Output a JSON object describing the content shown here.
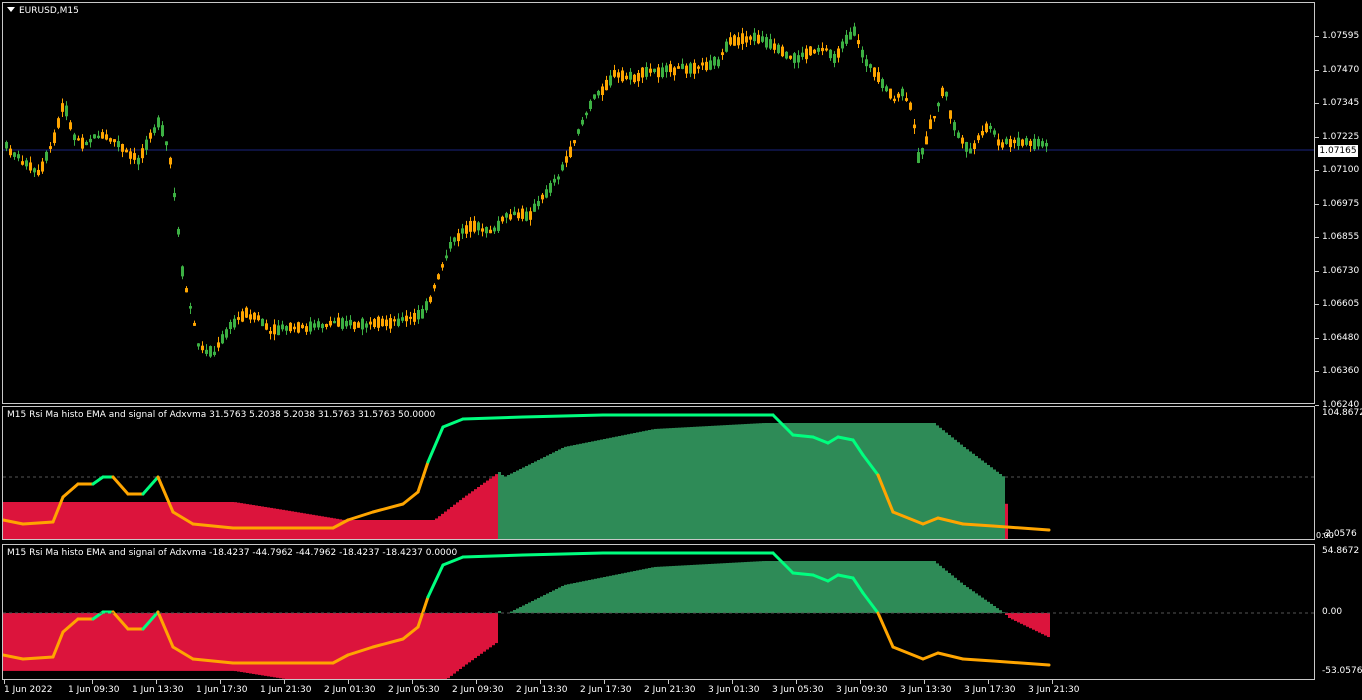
{
  "main": {
    "title": "EURUSD,M15",
    "current_price": "1.07165",
    "price_ticks": [
      "1.07595",
      "1.07470",
      "1.07345",
      "1.07225",
      "1.07100",
      "1.06975",
      "1.06855",
      "1.06730",
      "1.06605",
      "1.06480",
      "1.06360",
      "1.06240"
    ],
    "colors": {
      "bull": "#3cb043",
      "bear": "#ffa500",
      "current_line": "#1a237e"
    }
  },
  "indicator1": {
    "title": "M15 Rsi Ma histo EMA and signal of Adxvma  31.5763 5.2038 5.2038 31.5763 31.5763 50.0000",
    "scale_top": "104.8672",
    "scale_bottom": "-2.0576",
    "scale_bottom2": "0.00"
  },
  "indicator2": {
    "title": "M15 Rsi Ma histo EMA and signal of Adxvma  -18.4237 -44.7962 -44.7962 -18.4237 -18.4237 0.0000",
    "scale_top": "54.8672",
    "scale_mid": "0.00",
    "scale_bottom": "-53.0576"
  },
  "colors": {
    "histo_red": "#dc143c",
    "histo_green": "#2e8b57",
    "line_green": "#00ff7f",
    "line_orange": "#ffa500"
  },
  "time_labels": [
    "1 Jun 2022",
    "1 Jun 09:30",
    "1 Jun 13:30",
    "1 Jun 17:30",
    "1 Jun 21:30",
    "2 Jun 01:30",
    "2 Jun 05:30",
    "2 Jun 09:30",
    "2 Jun 13:30",
    "2 Jun 17:30",
    "2 Jun 21:30",
    "3 Jun 01:30",
    "3 Jun 05:30",
    "3 Jun 09:30",
    "3 Jun 13:30",
    "3 Jun 17:30",
    "3 Jun 21:30"
  ]
}
